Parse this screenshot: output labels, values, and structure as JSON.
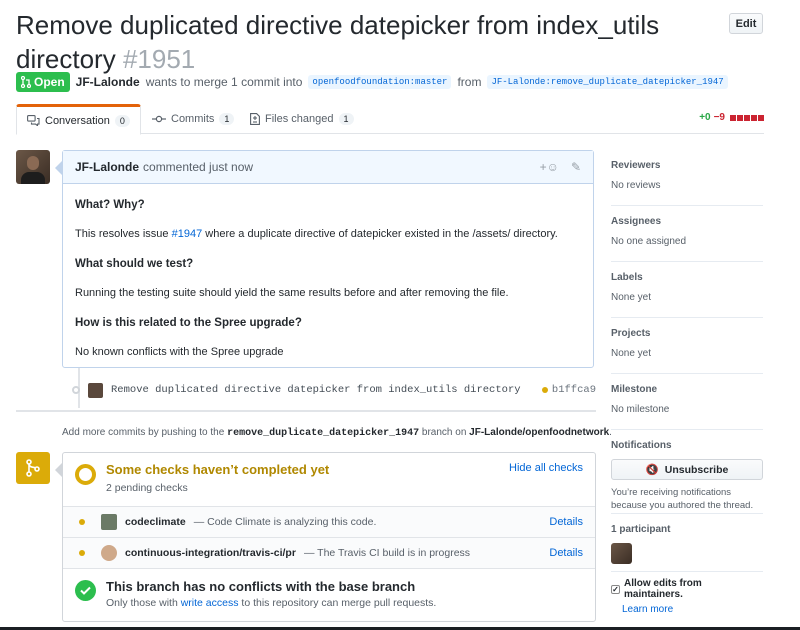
{
  "header": {
    "title": "Remove duplicated directive datepicker from index_utils directory",
    "number": "#1951",
    "edit_label": "Edit"
  },
  "meta": {
    "state": "Open",
    "author": "JF-Lalonde",
    "text": "wants to merge 1 commit into",
    "base_branch": "openfoodfoundation:master",
    "from_text": "from",
    "head_branch": "JF-Lalonde:remove_duplicate_datepicker_1947"
  },
  "tabs": [
    {
      "label": "Conversation",
      "count": "0"
    },
    {
      "label": "Commits",
      "count": "1"
    },
    {
      "label": "Files changed",
      "count": "1"
    }
  ],
  "diffstat": {
    "additions": "+0",
    "deletions": "−9"
  },
  "comment": {
    "author": "JF-Lalonde",
    "action": "commented just now",
    "h1": "What? Why?",
    "p1_prefix": "This resolves issue",
    "p1_link": "#1947",
    "p1_suffix": "where a duplicate directive of datepicker existed in the /assets/ directory.",
    "h2": "What should we test?",
    "p2": "Running the testing suite should yield the same results before and after removing the file.",
    "h3": "How is this related to the Spree upgrade?",
    "p3": "No known conflicts with the Spree upgrade"
  },
  "commit": {
    "message": "Remove duplicated directive datepicker from index_utils directory",
    "sha": "b1ffca9"
  },
  "push_note": {
    "prefix": "Add more commits by pushing to the",
    "branch": "remove_duplicate_datepicker_1947",
    "middle": "branch on",
    "repo": "JF-Lalonde/openfoodnetwork",
    "suffix": "."
  },
  "checks": {
    "title": "Some checks haven’t completed yet",
    "subtitle": "2 pending checks",
    "hide_label": "Hide all checks",
    "items": [
      {
        "name": "codeclimate",
        "desc": "— Code Climate is analyzing this code.",
        "details": "Details"
      },
      {
        "name": "continuous-integration/travis-ci/pr",
        "desc": "— The Travis CI build is in progress",
        "details": "Details"
      }
    ]
  },
  "merge": {
    "title": "This branch has no conflicts with the base branch",
    "sub_prefix": "Only those with",
    "sub_link": "write access",
    "sub_suffix": "to this repository can merge pull requests."
  },
  "sidebar": {
    "reviewers": {
      "heading": "Reviewers",
      "value": "No reviews"
    },
    "assignees": {
      "heading": "Assignees",
      "value": "No one assigned"
    },
    "labels": {
      "heading": "Labels",
      "value": "None yet"
    },
    "projects": {
      "heading": "Projects",
      "value": "None yet"
    },
    "milestone": {
      "heading": "Milestone",
      "value": "No milestone"
    },
    "notifications": {
      "heading": "Notifications",
      "button": "Unsubscribe",
      "text": "You’re receiving notifications because you authored the thread."
    },
    "participants": {
      "heading": "1 participant"
    },
    "allow_edits": "Allow edits from maintainers.",
    "learn_more": "Learn more"
  },
  "colors": {
    "open": "#2cbe4e",
    "pending": "#dbab09",
    "link": "#0366d6"
  }
}
